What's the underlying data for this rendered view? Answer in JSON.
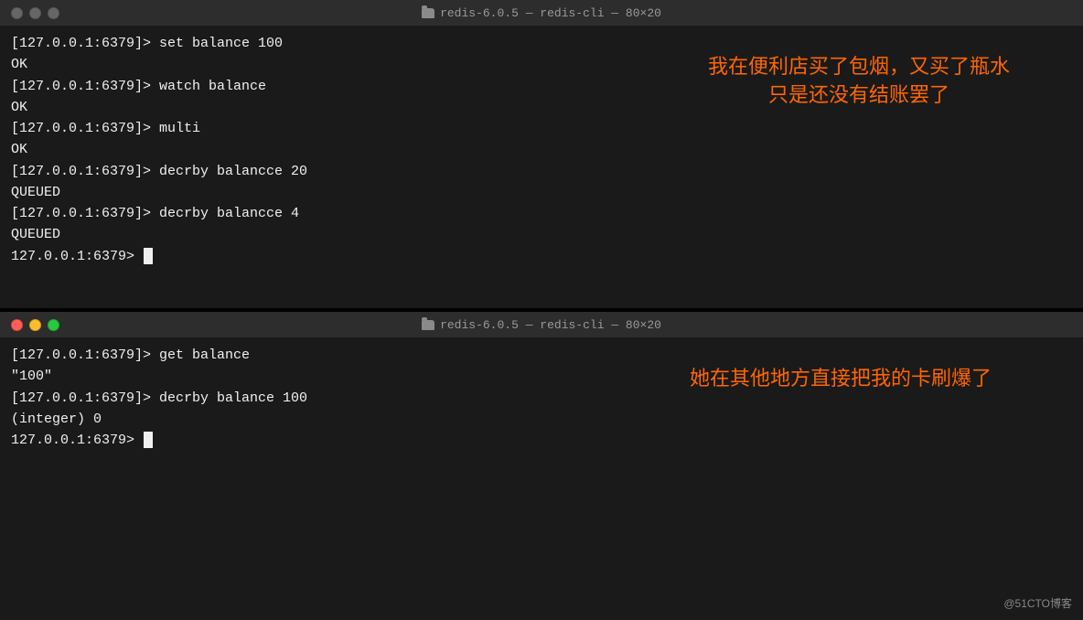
{
  "windows": {
    "top": {
      "title": "redis-6.0.5 — redis-cli — 80×20",
      "lines": [
        "[127.0.0.1:6379]> set balance 100",
        "OK",
        "[127.0.0.1:6379]> watch balance",
        "OK",
        "[127.0.0.1:6379]> multi",
        "OK",
        "[127.0.0.1:6379]> decrby balancce 20",
        "QUEUED",
        "[127.0.0.1:6379]> decrby balancce 4",
        "QUEUED",
        "127.0.0.1:6379> "
      ],
      "annotation_line1": "我在便利店买了包烟，又买了瓶水",
      "annotation_line2": "只是还没有结账罢了"
    },
    "bottom": {
      "title": "redis-6.0.5 — redis-cli — 80×20",
      "lines": [
        "[127.0.0.1:6379]> get balance",
        "\"100\"",
        "[127.0.0.1:6379]> decrby balance 100",
        "(integer) 0",
        "127.0.0.1:6379> "
      ],
      "annotation": "她在其他地方直接把我的卡刷爆了"
    }
  },
  "watermark": "@51CTO博客",
  "folder_icon_label": "folder-icon"
}
